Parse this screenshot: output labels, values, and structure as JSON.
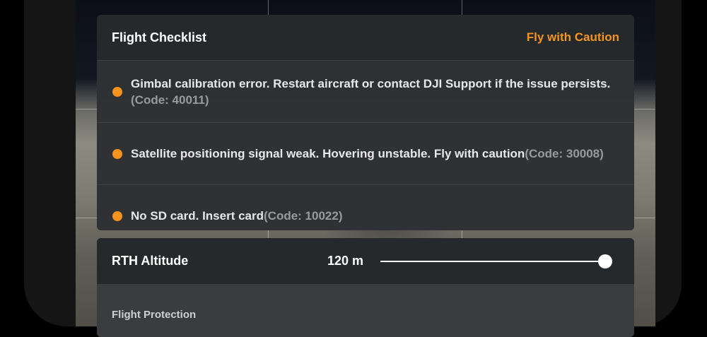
{
  "checklist": {
    "title": "Flight Checklist",
    "status": "Fly with Caution",
    "items": [
      {
        "text": "Gimbal calibration error. Restart aircraft or contact DJI Support if the issue persists.",
        "code": "(Code: 40011)"
      },
      {
        "text": "Satellite positioning signal weak. Hovering unstable. Fly with caution",
        "code": "(Code: 30008)"
      },
      {
        "text": "No SD card. Insert card",
        "code": "(Code: 10022)"
      }
    ]
  },
  "rth": {
    "label": "RTH Altitude",
    "value": "120 m",
    "slider_fraction": 1.0
  },
  "flight_protection": {
    "label": "Flight Protection"
  },
  "colors": {
    "accent": "#f5951f",
    "panel": "#26292c"
  }
}
